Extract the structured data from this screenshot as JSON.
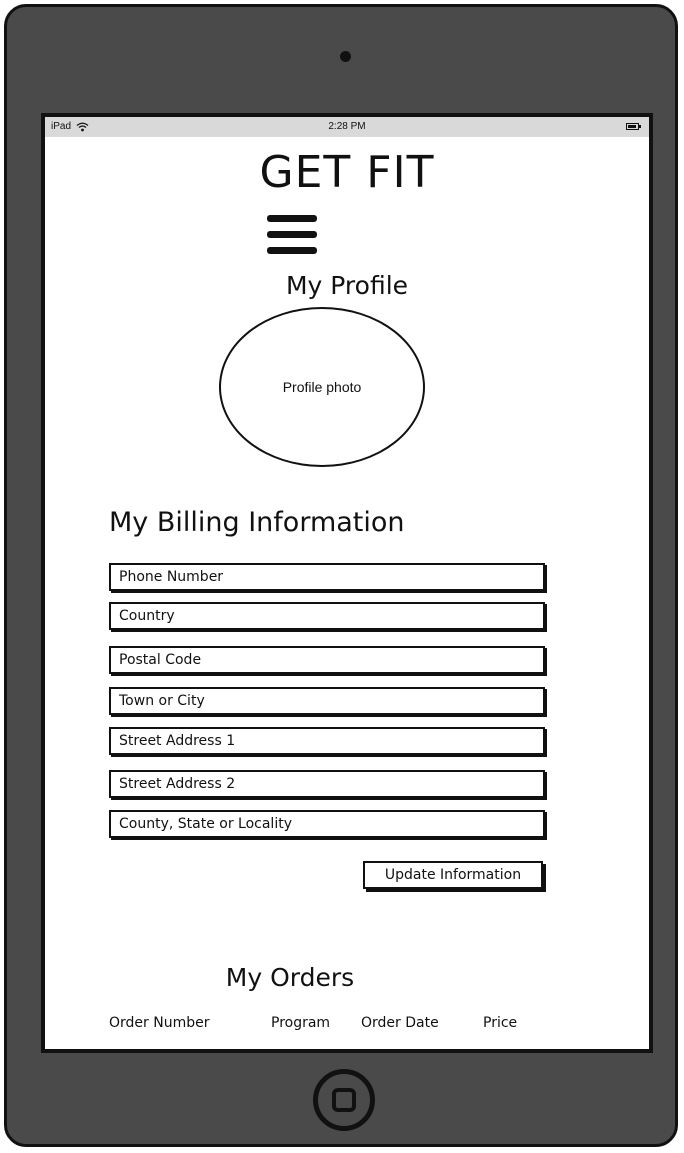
{
  "status_bar": {
    "device": "iPad",
    "time": "2:28 PM",
    "wifi_icon": "wifi-icon",
    "battery_icon": "battery-icon"
  },
  "header": {
    "title": "GET FIT",
    "menu_icon": "hamburger-menu-icon"
  },
  "profile": {
    "title": "My Profile",
    "photo_label": "Profile photo"
  },
  "billing": {
    "title": "My Billing Information",
    "fields": [
      "Phone Number",
      "Country",
      "Postal Code",
      "Town or City",
      "Street Address 1",
      "Street Address 2",
      "County, State or Locality"
    ],
    "update_button": "Update Information"
  },
  "orders": {
    "title": "My Orders",
    "columns": [
      "Order Number",
      "Program",
      "Order Date",
      "Price"
    ]
  },
  "colors": {
    "device_frame": "#4a4a4a",
    "status_bar": "#d9d9d9",
    "ink": "#111111"
  }
}
